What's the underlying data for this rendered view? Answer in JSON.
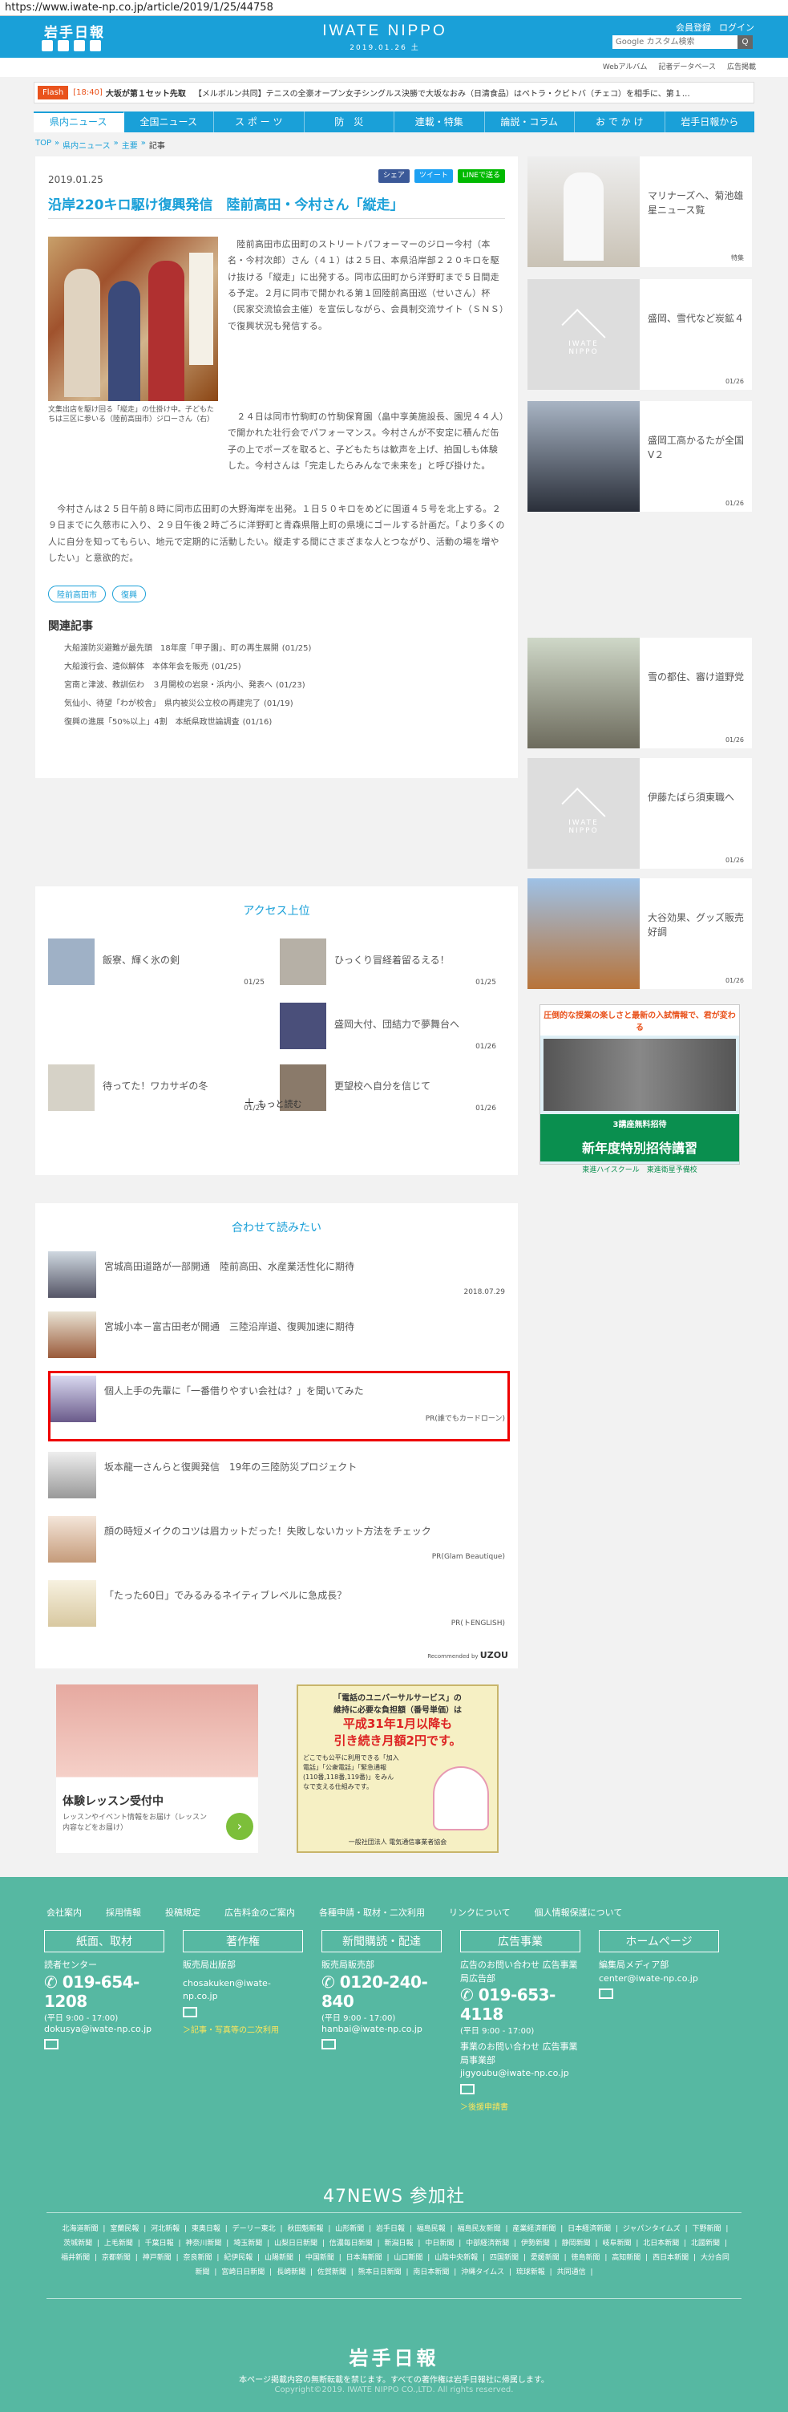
{
  "url": "https://www.iwate-np.co.jp/article/2019/1/25/44758",
  "header": {
    "logo": "岩手日報",
    "center_logo": "IWATE NIPPO",
    "date": "2019.01.26 土",
    "member": "会員登録",
    "login": "ログイン",
    "search_placeholder": "Google カスタム検索",
    "search_button": "Q"
  },
  "subnav": [
    "Webアルバム",
    "記者データベース",
    "広告掲載"
  ],
  "flash": {
    "tag": "Flash",
    "time": "[18:40]",
    "text1": "大坂が第１セット先取",
    "text2": "【メルボルン共同】テニスの全豪オープン女子シングルス決勝で大坂なおみ（日清食品）はペトラ・クビトバ（チェコ）を相手に、第１…"
  },
  "gnav": [
    "県内ニュース",
    "全国ニュース",
    "ス ポ ー ツ",
    "防　災",
    "連載・特集",
    "論説・コラム",
    "お で か け",
    "岩手日報から"
  ],
  "breadcrumb": [
    "TOP",
    "県内ニュース",
    "主要",
    "記事"
  ],
  "article": {
    "date": "2019.01.25",
    "share": "シェア",
    "tweet": "ツイート",
    "line": "LINEで送る",
    "title": "沿岸220キロ駆け復興発信　陸前高田・今村さん「縦走」",
    "caption": "文集出店を駆け回る「縦走」の仕掛け中。子どもたちは三区に参いる（陸前高田市）ジローさん（右）",
    "p1": "　陸前高田市広田町のストリートパフォーマーのジロー今村（本名・今村次郎）さん（４１）は２５日、本県沿岸部２２０キロを駆け抜ける「縦走」に出発する。同市広田町から洋野町まで５日間走る予定。２月に同市で開かれる第１回陸前高田巡（せいさん）杯（民家交流協会主催）を宣伝しながら、会員制交流サイト（ＳＮＳ）で復興状況も発信する。",
    "p2": "　２４日は同市竹駒町の竹駒保育園（畠中享美施設長、園児４４人）で開かれた壮行会でパフォーマンス。今村さんが不安定に積んだ缶子の上でポーズを取ると、子どもたちは歓声を上げ、拍国しも体験した。今村さんは「完走したらみんなで未来を」と呼び掛けた。",
    "p3": "　今村さんは２５日午前８時に同市広田町の大野海岸を出発。１日５０キロをめどに国道４５号を北上する。２９日までに久慈市に入り、２９日午後２時ごろに洋野町と青森県階上町の県境にゴールする計画だ。「より多くの人に自分を知ってもらい、地元で定期的に活動したい。縦走する間にさまざまな人とつながり、活動の場を増やしたい」と意欲的だ。",
    "tags": [
      "陸前高田市",
      "復興"
    ],
    "related_heading": "関連記事",
    "related": [
      {
        "t": "大船渡防災避難が最先頭　18年度「甲子園」、町の再生展開",
        "d": "(01/25)"
      },
      {
        "t": "大船渡行会、遠似解体　本体年会を販売",
        "d": "(01/25)"
      },
      {
        "t": "宮南と津波、教訓伝わ　３月開校の岩泉・浜内小、発表へ",
        "d": "(01/23)"
      },
      {
        "t": "気仙小、待望「わが校舎」　県内被災公立校の再建完了",
        "d": "(01/19)"
      },
      {
        "t": "復興の進展「50%以上」4割　本紙県政世論調査",
        "d": "(01/16)"
      }
    ]
  },
  "sidebar": [
    {
      "t": "マリナーズへ、菊池雄星ニュース覧",
      "d": "特集"
    },
    {
      "t": "盛岡、雪代など炭鉱４",
      "d": "01/26"
    },
    {
      "t": "盛岡工高かるたが全国V２",
      "d": "01/26"
    },
    {
      "t": "雪の都住、審け道野党",
      "d": "01/26"
    },
    {
      "t": "伊藤たばら須東職へ",
      "d": "01/26"
    },
    {
      "t": "大谷効果、グッズ販売好調",
      "d": "01/26"
    }
  ],
  "side_ad": {
    "head": "圧倒的な授業の楽しさと最新の入試情報で、君が変わる",
    "mid": "3講座無料招待",
    "title": "新年度特別招待講習",
    "foot": "東進ハイスクール　東進衛星予備校"
  },
  "access": {
    "heading": "アクセス上位",
    "items": [
      {
        "t": "飯寮、輝く氷の剣",
        "d": "01/25"
      },
      {
        "t": "ひっくり冒経着留るえる！",
        "d": "01/25"
      },
      {
        "t": "盛岡大付、団結力で夢舞台へ",
        "d": "01/26"
      },
      {
        "t": "待ってた！ワカサギの冬",
        "d": "01/25"
      },
      {
        "t": "更望校へ自分を信じて",
        "d": "01/26"
      }
    ],
    "more": "もっと読む"
  },
  "recommend": {
    "heading": "合わせて読みたい",
    "items": [
      {
        "t": "宮城高田道路が一部開通　陸前高田、水産業活性化に期待",
        "s": "2018.07.29"
      },
      {
        "t": "宮城小本－富古田老が開通　三陸沿岸道、復興加速に期待",
        "s": ""
      },
      {
        "t": "個人上手の先輩に「一番借りやすい会社は？」を聞いてみた",
        "s": "PR(誰でもカードローン)"
      },
      {
        "t": "坂本龍一さんらと復興発信　19年の三陸防災プロジェクト",
        "s": ""
      },
      {
        "t": "顔の時短メイクのコツは眉カットだった！失敗しないカット方法をチェック",
        "s": "PR(Glam Beautique)"
      },
      {
        "t": "「たった60日」でみるみるネイティブレベルに急成長？",
        "s": "PR(トENGLISH)"
      }
    ],
    "credit": "Recommended by",
    "brand": "UZOU"
  },
  "ad1": {
    "title": "体験レッスン受付中",
    "text": "レッスンやイベント情報をお届け（レッスン内容などをお届け）"
  },
  "ad2": {
    "l1": "「電話のユニバーサルサービス」の",
    "l2": "維持に必要な負担額（番号単価）は",
    "l3": "平成31年1月以降も",
    "l4": "引き続き月額2円です。",
    "l5": "どこでも公平に利用できる「加入電話」「公衆電話」「緊急通報(110番,118番,119番)」をみんなで支える仕組みです。",
    "l6": "一般社団法人 電気通信事業者協会"
  },
  "footer": {
    "nav": [
      "会社案内",
      "採用情報",
      "投稿規定",
      "広告料金のご案内",
      "各種申請・取材・二次利用",
      "リンクについて",
      "個人情報保護について"
    ],
    "cols": [
      {
        "h": "紙面、取材",
        "l1": "読者センター",
        "tel": "019-654-1208",
        "s": "(平日 9:00 - 17:00)",
        "m": "dokusya@iwate-np.co.jp"
      },
      {
        "h": "著作権",
        "l1": "販売局出版部",
        "tel": "",
        "s": "",
        "m": "chosakuken@iwate-np.co.jp",
        "y": "＞記事・写真等の二次利用"
      },
      {
        "h": "新聞購読・配達",
        "l1": "販売局販売部",
        "tel": "0120-240-840",
        "s": "(平日 9:00 - 17:00)",
        "m": "hanbai@iwate-np.co.jp"
      },
      {
        "h": "広告事業",
        "l1": "広告のお問い合わせ 広告事業局広告部",
        "tel": "019-653-4118",
        "s": "(平日 9:00 - 17:00)",
        "m2h": "事業のお問い合わせ 広告事業局事業部",
        "m": "jigyoubu@iwate-np.co.jp",
        "y": "＞後援申請書"
      },
      {
        "h": "ホームページ",
        "l1": "編集局メディア部",
        "tel": "",
        "s": "",
        "m": "center@iwate-np.co.jp"
      }
    ],
    "n47": "47NEWS 参加社",
    "papers": [
      "北海道新聞",
      "室蘭民報",
      "河北新報",
      "東奥日報",
      "デーリー東北",
      "秋田魁新報",
      "山形新聞",
      "岩手日報",
      "福島民報",
      "福島民友新聞",
      "産業経済新聞",
      "日本経済新聞",
      "ジャパンタイムズ",
      "下野新聞",
      "茨城新聞",
      "上毛新聞",
      "千葉日報",
      "神奈川新聞",
      "埼玉新聞",
      "山梨日日新聞",
      "信濃毎日新聞",
      "新潟日報",
      "中日新聞",
      "中部経済新聞",
      "伊勢新聞",
      "静岡新聞",
      "岐阜新聞",
      "北日本新聞",
      "北國新聞",
      "福井新聞",
      "京都新聞",
      "神戸新聞",
      "奈良新聞",
      "紀伊民報",
      "山陽新聞",
      "中国新聞",
      "日本海新聞",
      "山口新聞",
      "山陰中央新報",
      "四国新聞",
      "愛媛新聞",
      "徳島新聞",
      "高知新聞",
      "西日本新聞",
      "大分合同新聞",
      "宮崎日日新聞",
      "長崎新聞",
      "佐賀新聞",
      "熊本日日新聞",
      "南日本新聞",
      "沖縄タイムス",
      "琉球新報",
      "共同通信"
    ],
    "logo": "岩手日報",
    "note": "本ページ掲載内容の無断転載を禁じます。すべての著作権は岩手日報社に帰属します。",
    "copy": "Copyright©2019. IWATE NIPPO CO.,LTD. All rights reserved."
  }
}
